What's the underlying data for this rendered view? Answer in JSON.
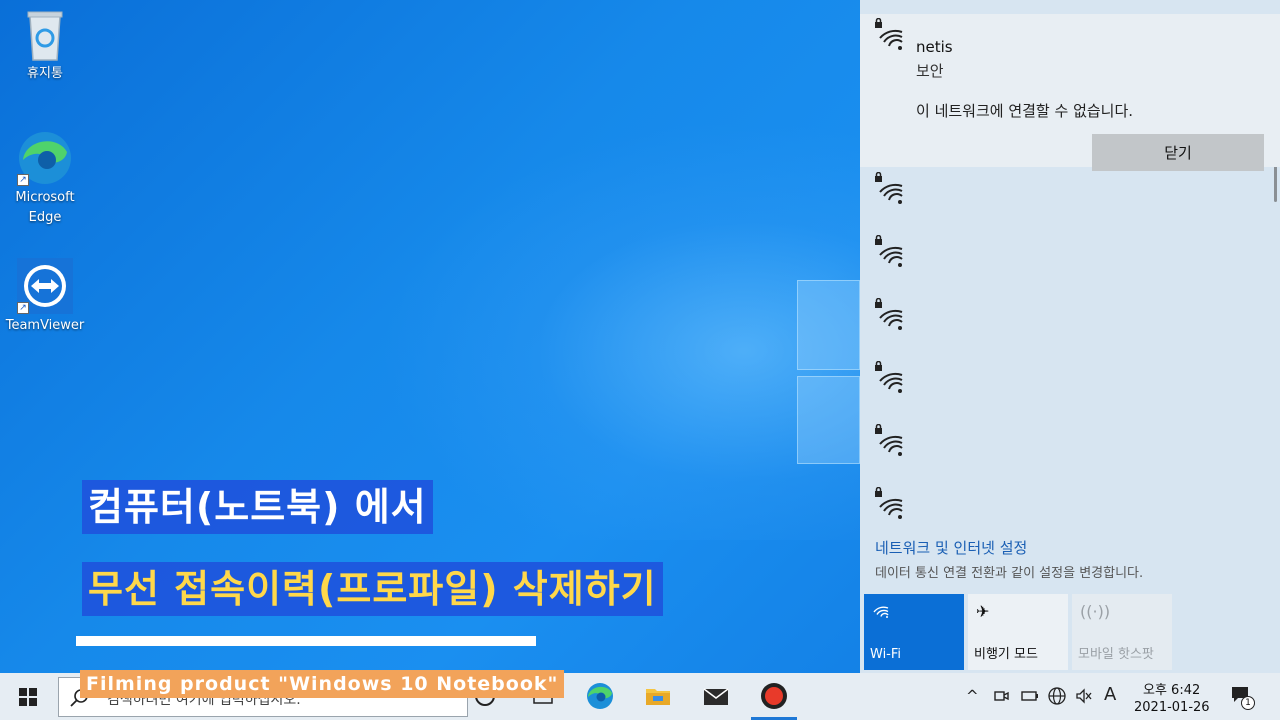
{
  "desktop": {
    "icons": [
      {
        "label": "휴지통"
      },
      {
        "label_line1": "Microsoft",
        "label_line2": "Edge"
      },
      {
        "label": "TeamViewer"
      }
    ]
  },
  "captions": {
    "line1": "컴퓨터(노트북) 에서",
    "line2": "무선 접속이력(프로파일) 삭제하기",
    "filming": "Filming product \"Windows 10 Notebook\""
  },
  "network": {
    "selected": {
      "name": "netis",
      "status": "보안",
      "message": "이 네트워크에 연결할 수 없습니다.",
      "close_label": "닫기"
    },
    "settings_title": "네트워크 및 인터넷 설정",
    "settings_subtitle": "데이터 통신 연결 전환과 같이 설정을 변경합니다.",
    "tiles": [
      {
        "label": "Wi-Fi",
        "active": true
      },
      {
        "label": "비행기 모드",
        "active": false
      },
      {
        "label": "모바일 핫스팟",
        "active": false
      }
    ]
  },
  "taskbar": {
    "search_placeholder": "검색하려면 여기에 입력하십시오.",
    "tray_input": "A",
    "notification_count": "1",
    "time": "오후 6:42",
    "date": "2021-01-26"
  },
  "colors": {
    "accent": "#0b6fd6",
    "caption_bg": "#1e50dc",
    "caption_yellow": "#ffd84a",
    "filming_bg": "#f2a35a"
  }
}
